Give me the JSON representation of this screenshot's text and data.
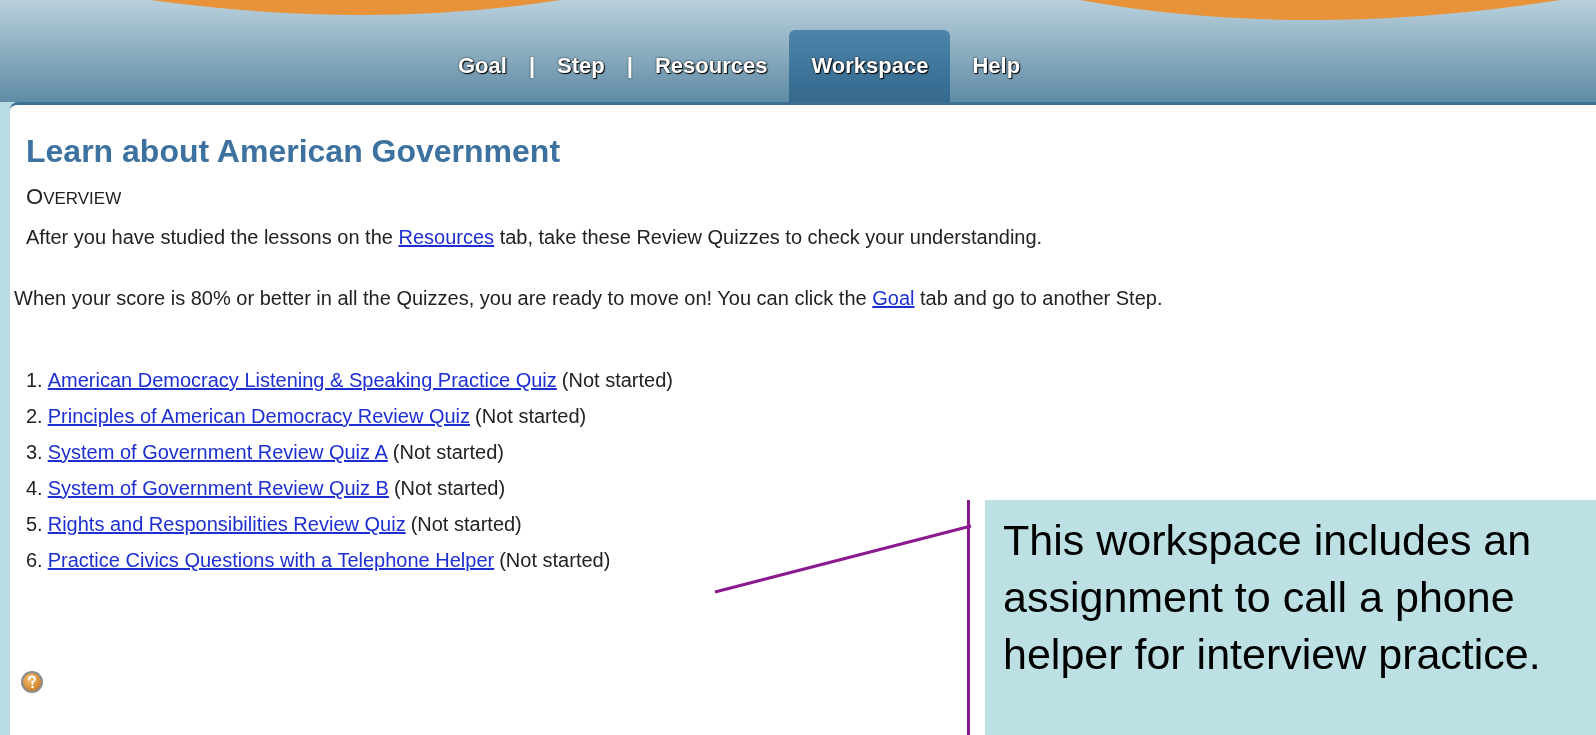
{
  "nav": {
    "items": [
      {
        "kind": "tab",
        "label": "Goal",
        "selected": false
      },
      {
        "kind": "separator",
        "label": "|"
      },
      {
        "kind": "tab",
        "label": "Step",
        "selected": false
      },
      {
        "kind": "separator",
        "label": "|"
      },
      {
        "kind": "tab",
        "label": "Resources",
        "selected": false
      },
      {
        "kind": "tab",
        "label": "Workspace",
        "selected": true
      },
      {
        "kind": "tab",
        "label": "Help",
        "selected": false
      }
    ]
  },
  "content": {
    "title": "Learn about American Government",
    "section_heading": "OVERVIEW",
    "paragraphs": [
      [
        {
          "kind": "text",
          "text": "After you have studied the lessons on the "
        },
        {
          "kind": "link",
          "text": "Resources"
        },
        {
          "kind": "text",
          "text": " tab, take these Review Quizzes to check your understanding."
        }
      ],
      [
        {
          "kind": "text",
          "text": "When your score is 80% or better in all the Quizzes, you are ready to move on! You can click the "
        },
        {
          "kind": "link",
          "text": "Goal"
        },
        {
          "kind": "text",
          "text": " tab and go to another Step."
        }
      ]
    ],
    "quizzes": [
      {
        "number": "1.",
        "title": "American Democracy Listening & Speaking Practice Quiz",
        "status": "(Not started)"
      },
      {
        "number": "2.",
        "title": "Principles of American Democracy Review Quiz",
        "status": "(Not started)"
      },
      {
        "number": "3.",
        "title": "System of Government Review Quiz A",
        "status": "(Not started)"
      },
      {
        "number": "4.",
        "title": "System of Government Review Quiz B",
        "status": "(Not started)"
      },
      {
        "number": "5.",
        "title": "Rights and Responsibilities Review Quiz",
        "status": "(Not started)"
      },
      {
        "number": "6.",
        "title": "Practice Civics Questions with a Telephone Helper",
        "status": "(Not started)"
      }
    ]
  },
  "callout": {
    "lines": [
      "This workspace includes an",
      "assignment to call a phone",
      "helper for interview practice."
    ]
  }
}
